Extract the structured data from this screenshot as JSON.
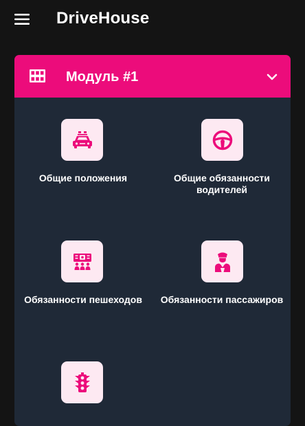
{
  "app": {
    "title": "DriveHouse",
    "menu_icon": "menu-icon"
  },
  "module": {
    "title": "Модуль #1",
    "icon": "grid-icon",
    "expand_icon": "chevron-down-icon",
    "accent_color": "#ec0c7b",
    "topics": [
      {
        "label": "Общие положения",
        "icon": "police-car-icon"
      },
      {
        "label": "Общие обязанности водителей",
        "icon": "steering-wheel-icon"
      },
      {
        "label": "Обязанности пешеходов",
        "icon": "pedestrians-icon"
      },
      {
        "label": "Обязанности пассажиров",
        "icon": "passenger-icon"
      },
      {
        "label": "",
        "icon": "traffic-light-icon"
      }
    ]
  },
  "colors": {
    "background": "#141414",
    "card": "#1f2937",
    "tile": "#fde9f2",
    "accent": "#ec0c7b"
  }
}
